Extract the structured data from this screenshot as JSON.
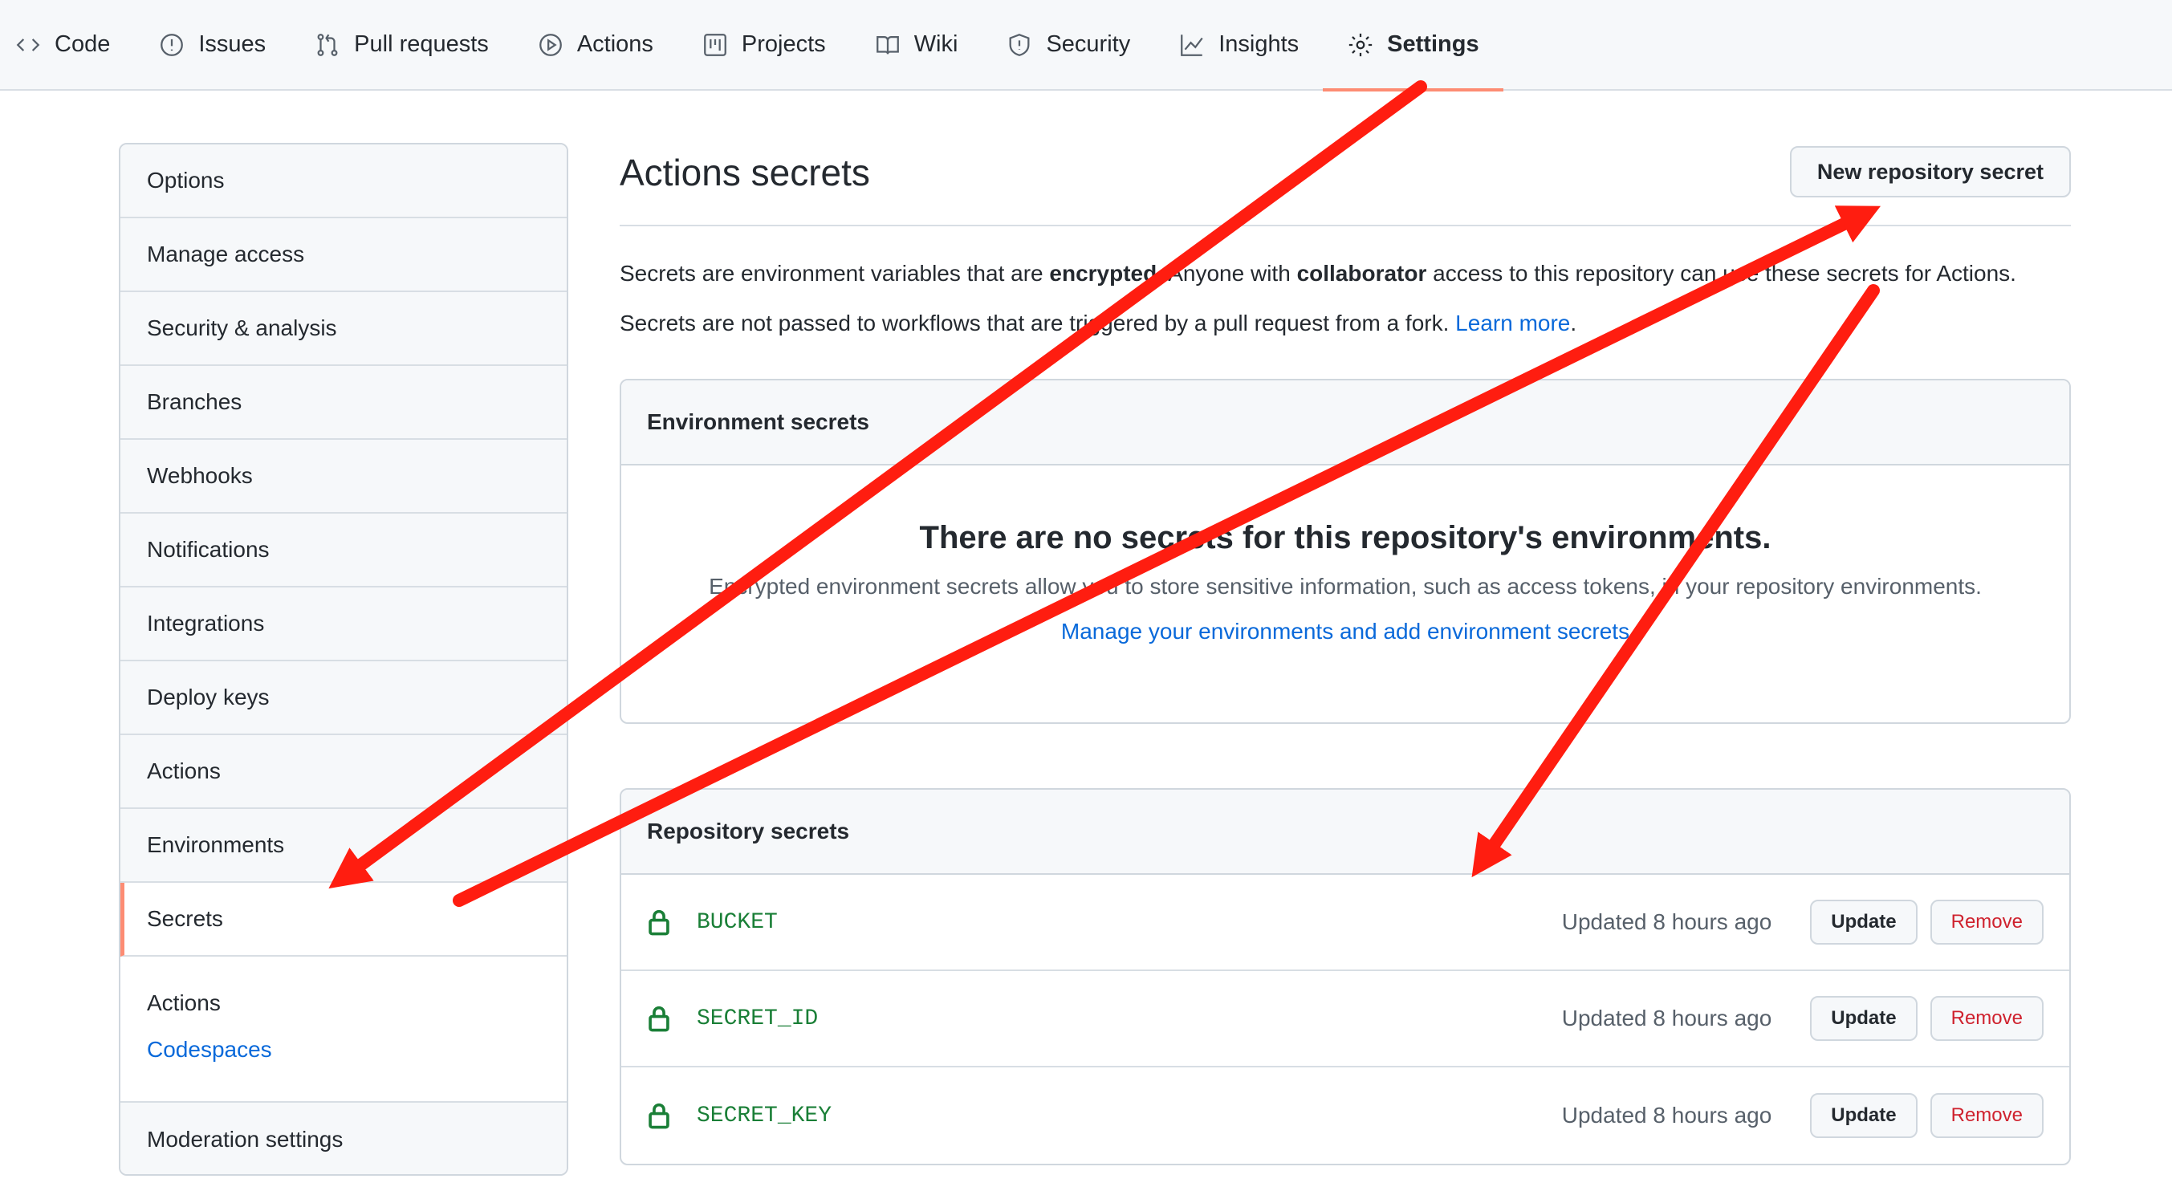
{
  "nav": {
    "tabs": [
      {
        "label": "Code",
        "icon": "code-icon"
      },
      {
        "label": "Issues",
        "icon": "issue-icon"
      },
      {
        "label": "Pull requests",
        "icon": "pull-request-icon"
      },
      {
        "label": "Actions",
        "icon": "play-icon"
      },
      {
        "label": "Projects",
        "icon": "project-icon"
      },
      {
        "label": "Wiki",
        "icon": "book-icon"
      },
      {
        "label": "Security",
        "icon": "shield-icon"
      },
      {
        "label": "Insights",
        "icon": "graph-icon"
      },
      {
        "label": "Settings",
        "icon": "gear-icon",
        "active": true
      }
    ]
  },
  "sidebar": {
    "items": [
      {
        "label": "Options"
      },
      {
        "label": "Manage access"
      },
      {
        "label": "Security & analysis"
      },
      {
        "label": "Branches"
      },
      {
        "label": "Webhooks"
      },
      {
        "label": "Notifications"
      },
      {
        "label": "Integrations"
      },
      {
        "label": "Deploy keys"
      },
      {
        "label": "Actions"
      },
      {
        "label": "Environments"
      },
      {
        "label": "Secrets",
        "selected": true
      }
    ],
    "group": {
      "title": "Actions",
      "link": "Codespaces"
    },
    "last_item": "Moderation settings"
  },
  "main": {
    "title": "Actions secrets",
    "new_button": "New repository secret",
    "desc1": {
      "pre": "Secrets are environment variables that are ",
      "bold1": "encrypted",
      "mid": ". Anyone with ",
      "bold2": "collaborator",
      "post": " access to this repository can use these secrets for Actions."
    },
    "desc2": {
      "pre": "Secrets are not passed to workflows that are triggered by a pull request from a fork. ",
      "link": "Learn more",
      "post": "."
    },
    "env": {
      "header": "Environment secrets",
      "blank_title": "There are no secrets for this repository's environments.",
      "blank_text": "Encrypted environment secrets allow you to store sensitive information, such as access tokens, in your repository environments.",
      "blank_link": "Manage your environments and add environment secrets"
    },
    "repo": {
      "header": "Repository secrets",
      "secrets": [
        {
          "name": "BUCKET",
          "updated": "Updated 8 hours ago",
          "update": "Update",
          "remove": "Remove"
        },
        {
          "name": "SECRET_ID",
          "updated": "Updated 8 hours ago",
          "update": "Update",
          "remove": "Remove"
        },
        {
          "name": "SECRET_KEY",
          "updated": "Updated 8 hours ago",
          "update": "Update",
          "remove": "Remove"
        }
      ]
    }
  },
  "colors": {
    "arrow": "#ff1d10",
    "accent": "#fd8c73",
    "link": "#0969da",
    "secret": "#1a7f37",
    "danger": "#cf222e"
  }
}
